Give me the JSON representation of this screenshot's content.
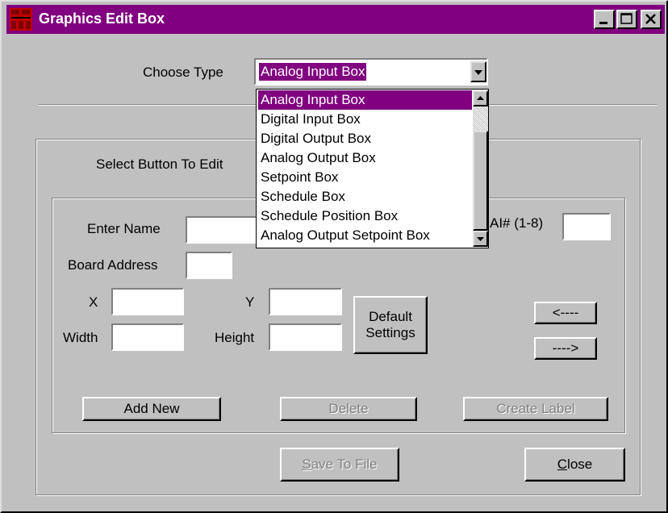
{
  "window": {
    "title": "Graphics Edit Box",
    "icon": "app-grid-icon",
    "controls": [
      "minimize-icon",
      "maximize-icon",
      "close-icon"
    ]
  },
  "type_selector": {
    "label": "Choose Type",
    "selected": "Analog Input Box",
    "options": [
      "Analog Input Box",
      "Digital Input Box",
      "Digital Output Box",
      "Analog Output Box",
      "Setpoint Box",
      "Schedule Box",
      "Schedule Position Box",
      "Analog Output Setpoint Box"
    ]
  },
  "select_button_label": "Select Button To Edit",
  "form": {
    "enter_name_label": "Enter Name",
    "enter_name_value": "",
    "ai_label": "AI# (1-8)",
    "ai_value": "",
    "board_address_label": "Board Address",
    "board_address_value": "",
    "x_label": "X",
    "x_value": "",
    "y_label": "Y",
    "y_value": "",
    "width_label": "Width",
    "width_value": "",
    "height_label": "Height",
    "height_value": "",
    "default_settings_line1": "Default",
    "default_settings_line2": "Settings",
    "prev_label": "<----",
    "next_label": "---->"
  },
  "actions": {
    "add_new": "Add New",
    "delete": "Delete",
    "create_label": "Create Label"
  },
  "footer": {
    "save_hotkey": "S",
    "save_rest": "ave To File",
    "close_hotkey": "C",
    "close_rest": "lose"
  },
  "colors": {
    "titlebar": "#800080",
    "face": "#c0c0c0",
    "selection": "#800080"
  }
}
